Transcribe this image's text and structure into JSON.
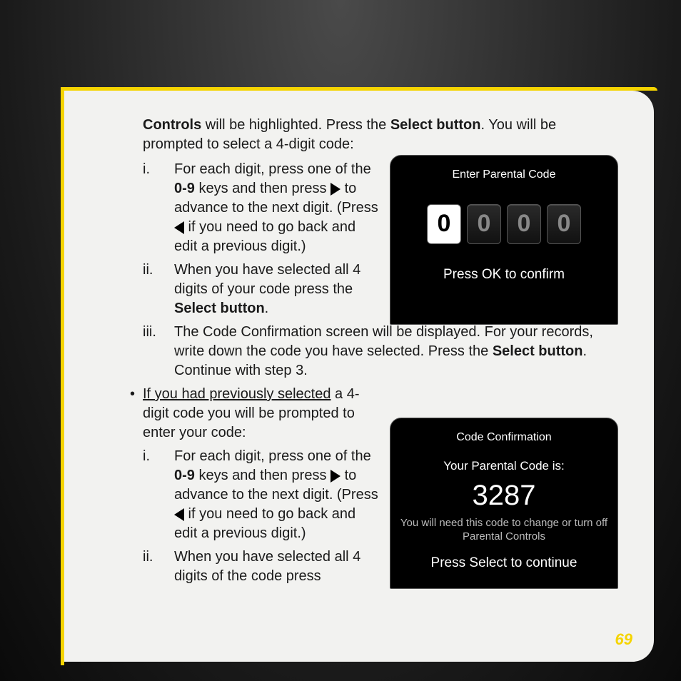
{
  "intro": {
    "part1": "Controls",
    "part2": " will be highlighted. Press the ",
    "part3": "Select button",
    "part4": ". You will be prompted to select a 4-digit code:"
  },
  "listA": {
    "i": {
      "marker": "i.",
      "t1": "For each digit, press one of the ",
      "keys": "0-9",
      "t2": " keys and then press ",
      "t3": " to advance to the next digit. (Press ",
      "t4": " if you need to go back and edit a previous digit.)"
    },
    "ii": {
      "marker": "ii.",
      "t1": "When you have selected all 4 digits of your code press the ",
      "bold": "Select button",
      "t2": "."
    },
    "iii": {
      "marker": "iii.",
      "t1": "The Code Confirmation screen will be displayed. For your records, write down the code you have selected. Press the ",
      "bold": "Select button",
      "t2": ". Continue with step 3."
    }
  },
  "bullet": {
    "dot": "•",
    "u": "If you had previously selected",
    "rest": " a 4-digit code you will be prompted to enter your code:"
  },
  "listB": {
    "i": {
      "marker": "i.",
      "t1": "For each digit, press one of the ",
      "keys": "0-9",
      "t2": " keys and then press ",
      "t3": " to advance to the next digit. (Press ",
      "t4": " if you need to go back and edit a previous digit.)"
    },
    "ii": {
      "marker": "ii.",
      "t1": "When you have selected all 4 digits of the code press"
    }
  },
  "screen1": {
    "title": "Enter Parental Code",
    "digits": [
      "0",
      "0",
      "0",
      "0"
    ],
    "footer": "Press OK to confirm"
  },
  "screen2": {
    "title": "Code Confirmation",
    "sub": "Your Parental Code is:",
    "code": "3287",
    "note": "You will need this code to change or turn off Parental Controls",
    "footer": "Press Select to continue"
  },
  "pageNumber": "69"
}
